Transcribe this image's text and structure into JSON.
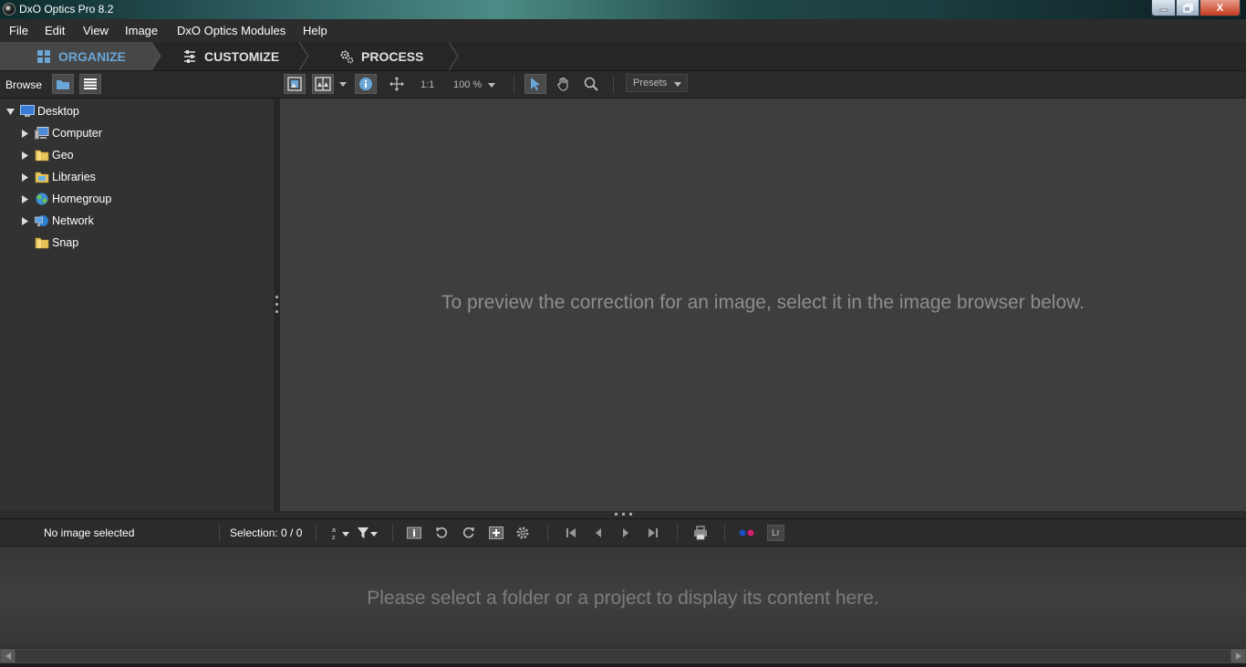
{
  "window": {
    "title": "DxO Optics Pro 8.2",
    "close_label": "X"
  },
  "menu": [
    "File",
    "Edit",
    "View",
    "Image",
    "DxO Optics Modules",
    "Help"
  ],
  "tabs": {
    "organize": "ORGANIZE",
    "customize": "CUSTOMIZE",
    "process": "PROCESS"
  },
  "toolbar": {
    "browse_label": "Browse",
    "ratio_label": "1:1",
    "zoom_value": "100 %",
    "presets_label": "Presets"
  },
  "tree": {
    "root": "Desktop",
    "items": [
      "Computer",
      "Geo",
      "Libraries",
      "Homegroup",
      "Network",
      "Snap"
    ]
  },
  "preview": {
    "message": "To preview the correction for an image, select it in the image browser below."
  },
  "status": {
    "image_status": "No image selected",
    "selection": "Selection: 0 / 0",
    "lightroom_label": "Lr"
  },
  "browser": {
    "message": "Please select a folder or a project to display its content here."
  },
  "colors": {
    "accent": "#6aa6d8",
    "background": "#3e3e3e",
    "panel": "#323232"
  }
}
